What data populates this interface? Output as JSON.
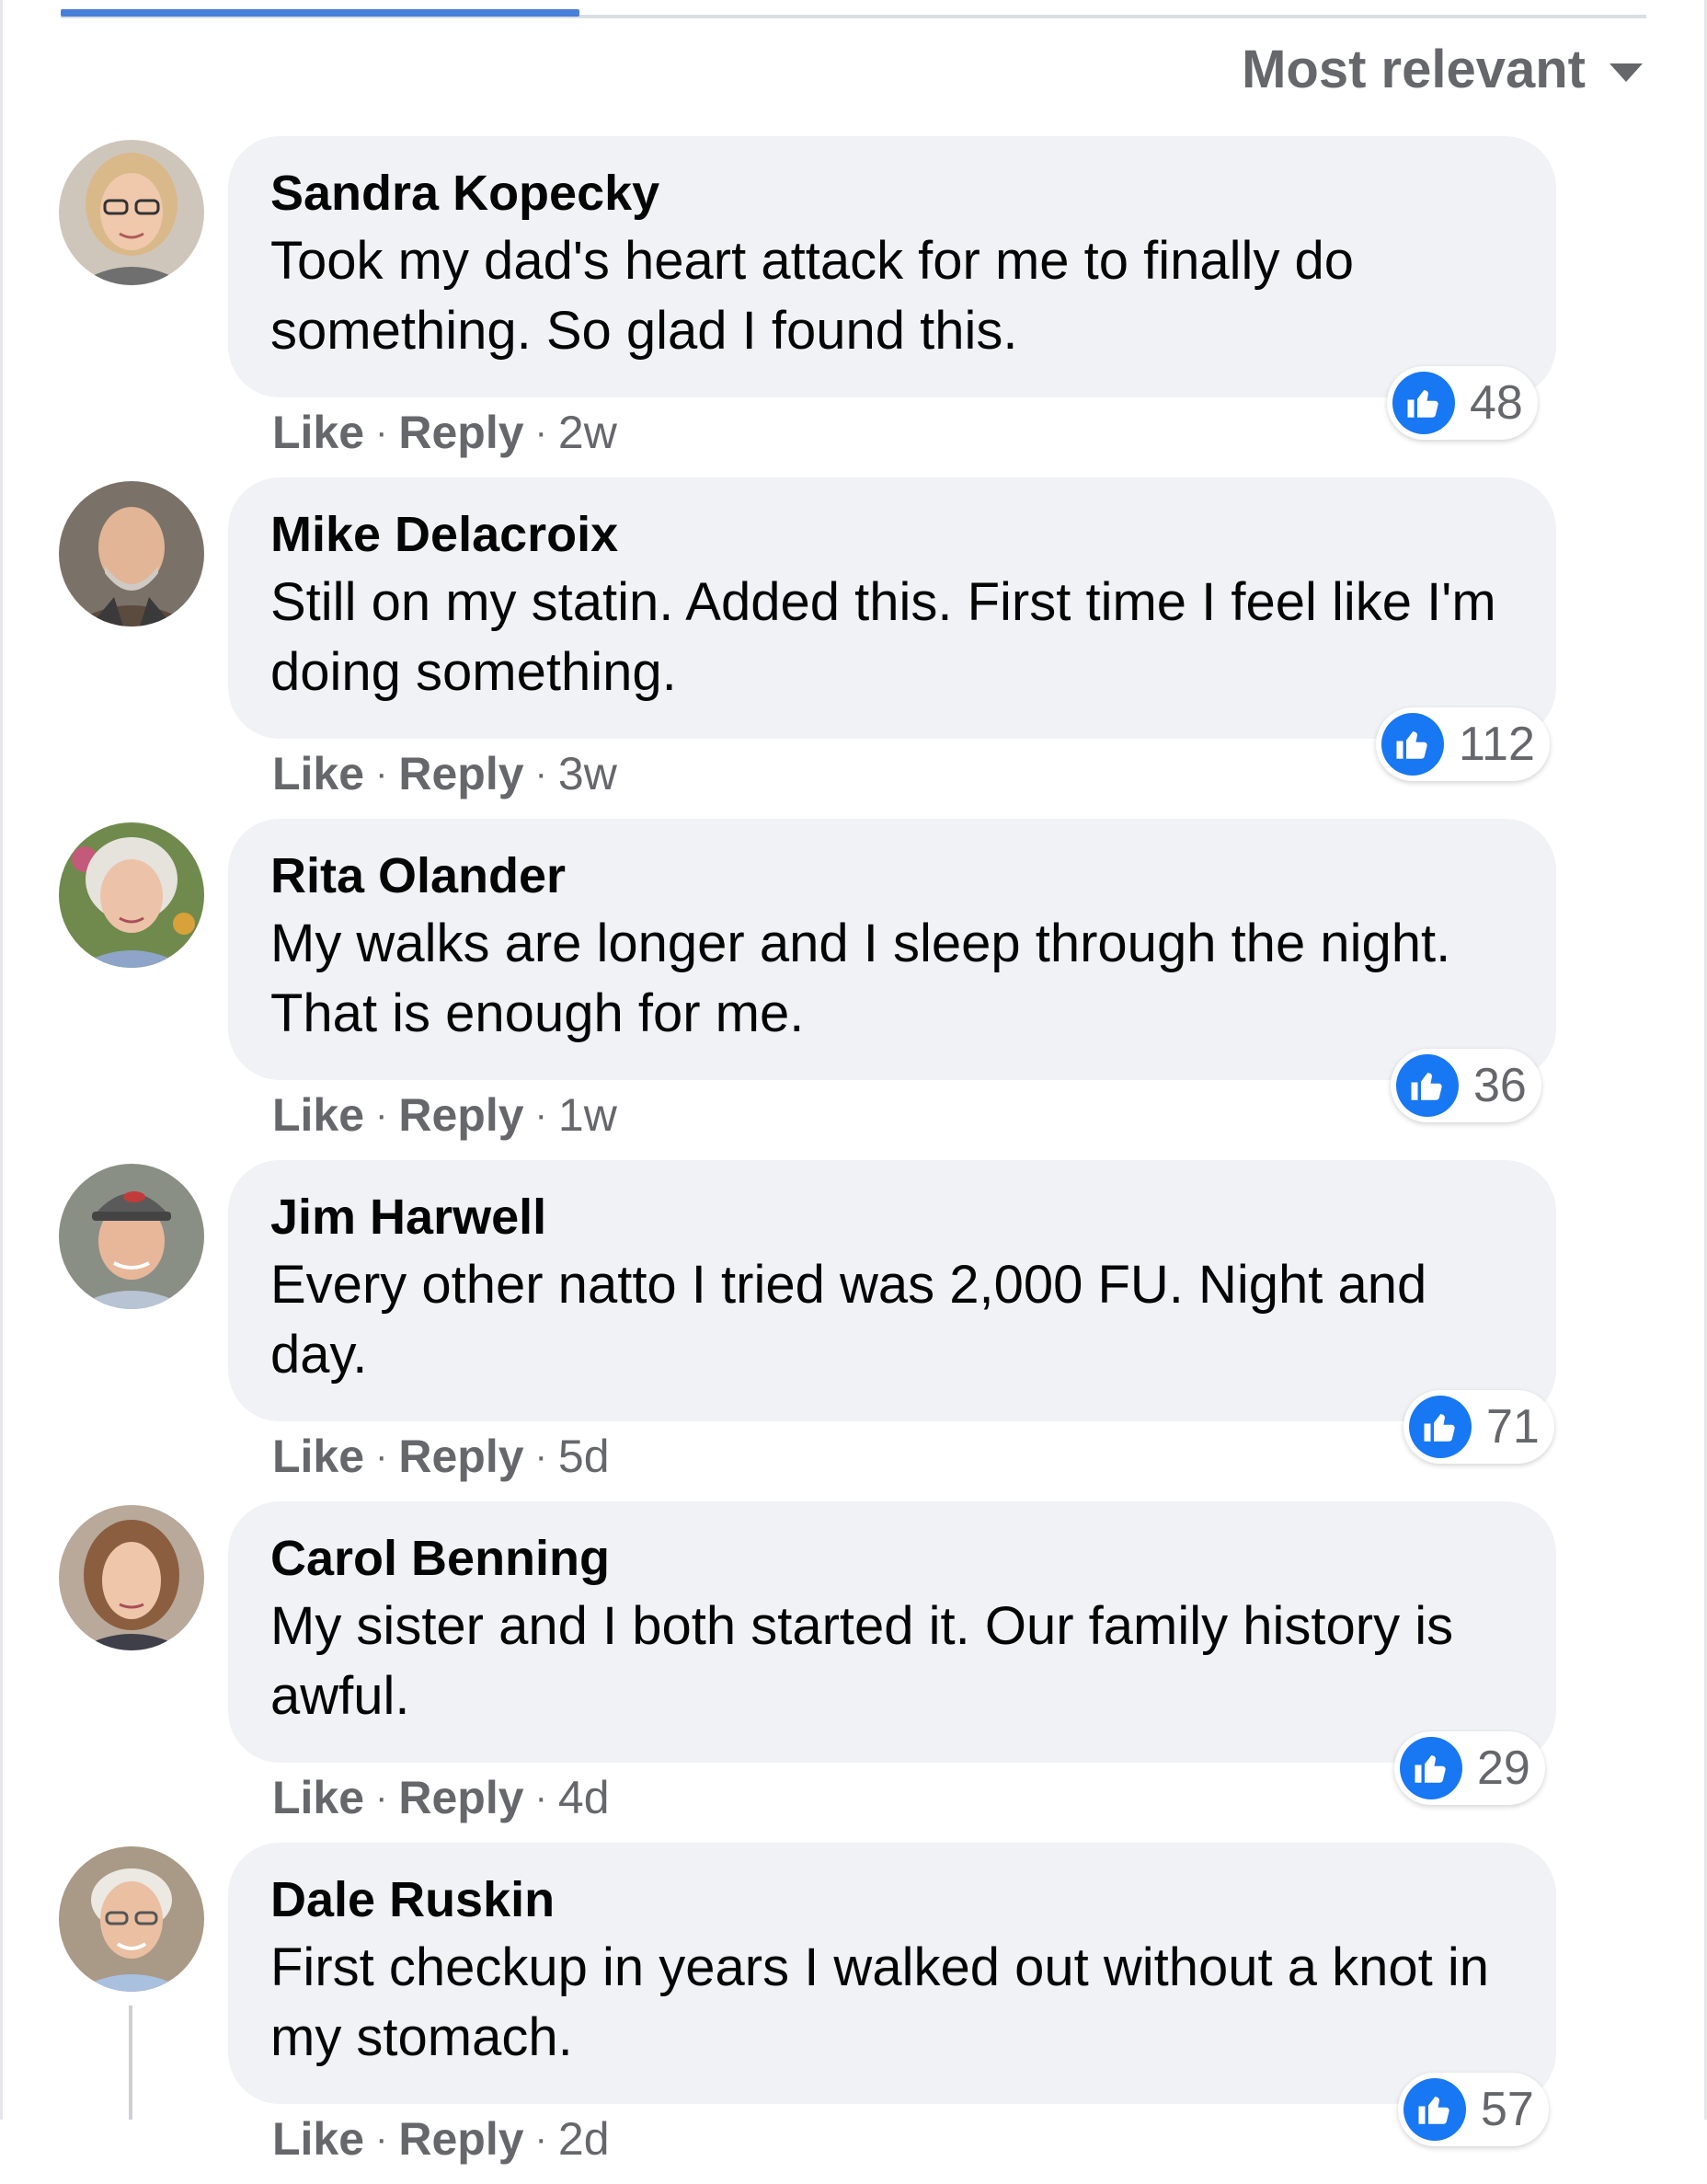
{
  "sort": {
    "label": "Most relevant"
  },
  "colors": {
    "accent": "#1877f2",
    "tab_indicator": "#4a7fd8",
    "bubble": "#f0f2f5",
    "meta_text": "#65676b"
  },
  "actions": {
    "like": "Like",
    "reply": "Reply",
    "separator": "·"
  },
  "comments": [
    {
      "author": "Sandra Kopecky",
      "text": "Took my dad's heart attack for me to finally do something. So glad I found this.",
      "time": "2w",
      "likes": "48"
    },
    {
      "author": "Mike Delacroix",
      "text": "Still on my statin. Added this. First time I feel like I'm doing something.",
      "time": "3w",
      "likes": "112"
    },
    {
      "author": "Rita Olander",
      "text": "My walks are longer and I sleep through the night. That is enough for me.",
      "time": "1w",
      "likes": "36"
    },
    {
      "author": "Jim Harwell",
      "text": "Every other natto I tried was 2,000 FU. Night and day.",
      "time": "5d",
      "likes": "71"
    },
    {
      "author": "Carol Benning",
      "text": "My sister and I both started it. Our family history is awful.",
      "time": "4d",
      "likes": "29"
    },
    {
      "author": "Dale Ruskin",
      "text": "First checkup in years I walked out without a knot in my stomach.",
      "time": "2d",
      "likes": "57"
    }
  ]
}
